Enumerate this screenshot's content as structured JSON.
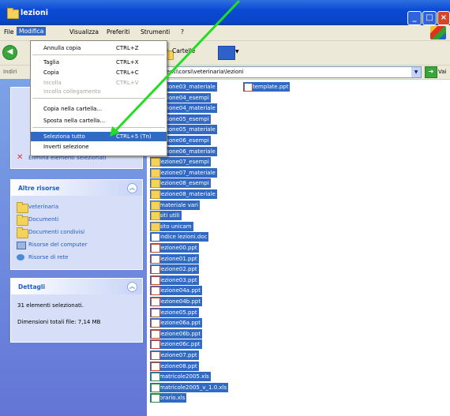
{
  "window": {
    "title": "lezioni"
  },
  "menubar": {
    "items": [
      "File",
      "Modifica",
      "Visualizza",
      "Preferiti",
      "Strumenti",
      "?"
    ]
  },
  "toolbar": {
    "folders_label": "Cartelle"
  },
  "addressbar": {
    "label": "Indiri",
    "path": "...enti\\corsi\\veterinaria\\lezioni",
    "go_label": "Vai"
  },
  "edit_menu": {
    "items": [
      {
        "label": "Annulla copia",
        "shortcut": "CTRL+Z",
        "disabled": false
      },
      {
        "label": "Taglia",
        "shortcut": "CTRL+X",
        "disabled": false
      },
      {
        "label": "Copia",
        "shortcut": "CTRL+C",
        "disabled": false
      },
      {
        "label": "Incolla",
        "shortcut": "CTRL+V",
        "disabled": true
      },
      {
        "label": "Incolla collegamento",
        "shortcut": "",
        "disabled": true
      },
      {
        "label": "Copia nella cartella...",
        "shortcut": "",
        "disabled": false
      },
      {
        "label": "Sposta nella cartella...",
        "shortcut": "",
        "disabled": false
      },
      {
        "label": "Seleziona tutto",
        "shortcut": "CTRL+5 (Tn)",
        "disabled": false,
        "highlighted": true
      },
      {
        "label": "Inverti selezione",
        "shortcut": "",
        "disabled": false
      }
    ]
  },
  "taskpane": {
    "delete_label": "Elimina elementi selezionati",
    "other_places": {
      "title": "Altre risorse",
      "items": [
        "veterinaria",
        "Documenti",
        "Documenti condivisi",
        "Risorse del computer",
        "Risorse di rete"
      ]
    },
    "details": {
      "title": "Dettagli",
      "selected": "31 elementi selezionati.",
      "size": "Dimensioni totali file: 7,14 MB"
    }
  },
  "files": [
    {
      "name": "lezione03_materiale",
      "type": "folder"
    },
    {
      "name": "lezione04_esempi",
      "type": "folder"
    },
    {
      "name": "lezione04_materiale",
      "type": "folder"
    },
    {
      "name": "lezione05_esempi",
      "type": "folder"
    },
    {
      "name": "lezione05_materiale",
      "type": "folder"
    },
    {
      "name": "lezione06_esempi",
      "type": "folder"
    },
    {
      "name": "lezione06_materiale",
      "type": "folder"
    },
    {
      "name": "lezione07_esempi",
      "type": "folder"
    },
    {
      "name": "lezione07_materiale",
      "type": "folder"
    },
    {
      "name": "lezione08_esempi",
      "type": "folder"
    },
    {
      "name": "lezione08_materiale",
      "type": "folder"
    },
    {
      "name": "materiale vari",
      "type": "folder"
    },
    {
      "name": "siti utili",
      "type": "folder"
    },
    {
      "name": "sito unicam",
      "type": "folder"
    },
    {
      "name": "indice lezioni.doc",
      "type": "doc"
    },
    {
      "name": "lezione00.ppt",
      "type": "ppt"
    },
    {
      "name": "lezione01.ppt",
      "type": "ppt"
    },
    {
      "name": "lezione02.ppt",
      "type": "ppt"
    },
    {
      "name": "lezione03.ppt",
      "type": "ppt"
    },
    {
      "name": "lezione04a.ppt",
      "type": "ppt"
    },
    {
      "name": "lezione04b.ppt",
      "type": "ppt"
    },
    {
      "name": "lezione05.ppt",
      "type": "ppt"
    },
    {
      "name": "lezione06a.ppt",
      "type": "ppt"
    },
    {
      "name": "lezione06b.ppt",
      "type": "ppt"
    },
    {
      "name": "lezione06c.ppt",
      "type": "ppt"
    },
    {
      "name": "lezione07.ppt",
      "type": "ppt"
    },
    {
      "name": "lezione08.ppt",
      "type": "ppt"
    },
    {
      "name": "matricole2005.xls",
      "type": "xls"
    },
    {
      "name": "matricole2005_v_1.0.xls",
      "type": "xls"
    },
    {
      "name": "orario.xls",
      "type": "xls"
    }
  ],
  "extra_file": {
    "name": "template.ppt",
    "type": "ppt"
  }
}
